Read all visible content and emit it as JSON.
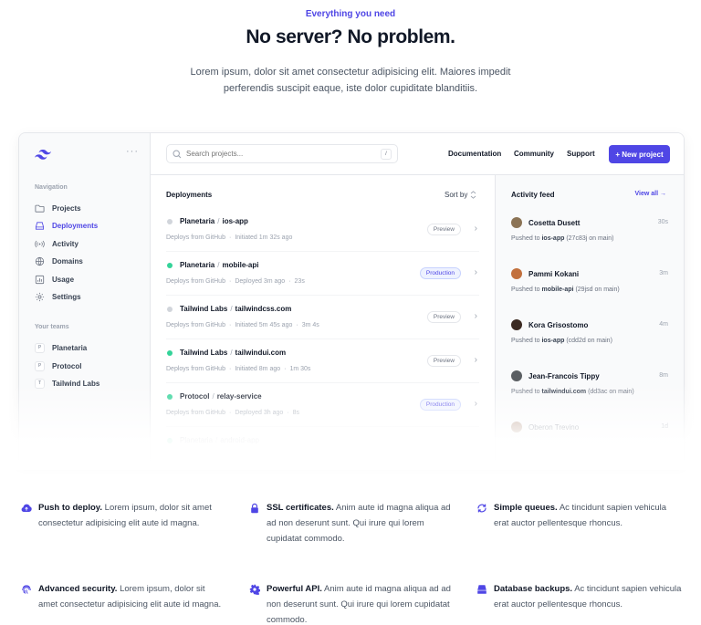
{
  "hero": {
    "eyebrow": "Everything you need",
    "headline": "No server? No problem.",
    "lede": "Lorem ipsum, dolor sit amet consectetur adipisicing elit. Maiores impedit perferendis suscipit eaque, iste dolor cupiditate blanditiis."
  },
  "app": {
    "sidebar": {
      "more_icon": "ellipsis-icon",
      "navigation_label": "Navigation",
      "nav": [
        {
          "label": "Projects",
          "icon": "folder-icon"
        },
        {
          "label": "Deployments",
          "icon": "server-icon",
          "active": true
        },
        {
          "label": "Activity",
          "icon": "signal-icon"
        },
        {
          "label": "Domains",
          "icon": "globe-icon"
        },
        {
          "label": "Usage",
          "icon": "chart-bar-icon"
        },
        {
          "label": "Settings",
          "icon": "gear-icon"
        }
      ],
      "teams_label": "Your teams",
      "teams": [
        {
          "initial": "P",
          "label": "Planetaria"
        },
        {
          "initial": "P",
          "label": "Protocol"
        },
        {
          "initial": "T",
          "label": "Tailwind Labs"
        }
      ]
    },
    "topbar": {
      "search_placeholder": "Search projects...",
      "search_shortcut": "/",
      "links": [
        "Documentation",
        "Community",
        "Support"
      ],
      "new_project": "+ New project"
    },
    "deployments": {
      "title": "Deployments",
      "sort_label": "Sort by",
      "rows": [
        {
          "team": "Planetaria",
          "project": "ios-app",
          "source": "Deploys from GitHub",
          "status_text": "Initiated 1m 32s ago",
          "duration": "",
          "environment": "Preview",
          "status_color": "#d1d5db"
        },
        {
          "team": "Planetaria",
          "project": "mobile-api",
          "source": "Deploys from GitHub",
          "status_text": "Deployed 3m ago",
          "duration": "23s",
          "environment": "Production",
          "status_color": "#34d399"
        },
        {
          "team": "Tailwind Labs",
          "project": "tailwindcss.com",
          "source": "Deploys from GitHub",
          "status_text": "Initiated 5m 45s ago",
          "duration": "3m 4s",
          "environment": "Preview",
          "status_color": "#d1d5db"
        },
        {
          "team": "Tailwind Labs",
          "project": "tailwindui.com",
          "source": "Deploys from GitHub",
          "status_text": "Initiated 8m ago",
          "duration": "1m 30s",
          "environment": "Preview",
          "status_color": "#34d399"
        },
        {
          "team": "Protocol",
          "project": "relay-service",
          "source": "Deploys from GitHub",
          "status_text": "Deployed 3h ago",
          "duration": "8s",
          "environment": "Production",
          "status_color": "#34d399"
        },
        {
          "team": "Planetaria",
          "project": "android-app",
          "source": "",
          "status_text": "",
          "duration": "",
          "environment": "",
          "status_color": "#34d399"
        }
      ]
    },
    "activity": {
      "title": "Activity feed",
      "view_all": "View all →",
      "items": [
        {
          "name": "Cosetta Dusett",
          "time": "30s",
          "prefix": "Pushed to",
          "target": "ios-app",
          "detail": "(27c83j on main)",
          "avatar_color": "#8b7355"
        },
        {
          "name": "Pammi Kokani",
          "time": "3m",
          "prefix": "Pushed to",
          "target": "mobile-api",
          "detail": "(29jsd on main)",
          "avatar_color": "#c2703d"
        },
        {
          "name": "Kora Grisostomo",
          "time": "4m",
          "prefix": "Pushed to",
          "target": "ios-app",
          "detail": "(cdd2d on main)",
          "avatar_color": "#3b2a22"
        },
        {
          "name": "Jean-Francois Tippy",
          "time": "8m",
          "prefix": "Pushed to",
          "target": "tailwindui.com",
          "detail": "(dd3ac on main)",
          "avatar_color": "#5b5f63"
        },
        {
          "name": "Oberon Trevino",
          "time": "1d",
          "prefix": "",
          "target": "",
          "detail": "",
          "avatar_color": "#b89a8a"
        }
      ]
    }
  },
  "features": [
    {
      "icon": "cloud-upload-icon",
      "title": "Push to deploy.",
      "text": "Lorem ipsum, dolor sit amet consectetur adipisicing elit aute id magna."
    },
    {
      "icon": "lock-icon",
      "title": "SSL certificates.",
      "text": "Anim aute id magna aliqua ad ad non deserunt sunt. Qui irure qui lorem cupidatat commodo."
    },
    {
      "icon": "refresh-icon",
      "title": "Simple queues.",
      "text": "Ac tincidunt sapien vehicula erat auctor pellentesque rhoncus."
    },
    {
      "icon": "fingerprint-icon",
      "title": "Advanced security.",
      "text": "Lorem ipsum, dolor sit amet consectetur adipisicing elit aute id magna."
    },
    {
      "icon": "gear-icon",
      "title": "Powerful API.",
      "text": "Anim aute id magna aliqua ad ad non deserunt sunt. Qui irure qui lorem cupidatat commodo."
    },
    {
      "icon": "server-icon",
      "title": "Database backups.",
      "text": "Ac tincidunt sapien vehicula erat auctor pellentesque rhoncus."
    }
  ],
  "colors": {
    "accent": "#4f46e5",
    "heading": "#111827",
    "body": "#4b5563",
    "muted": "#9ca3af"
  }
}
